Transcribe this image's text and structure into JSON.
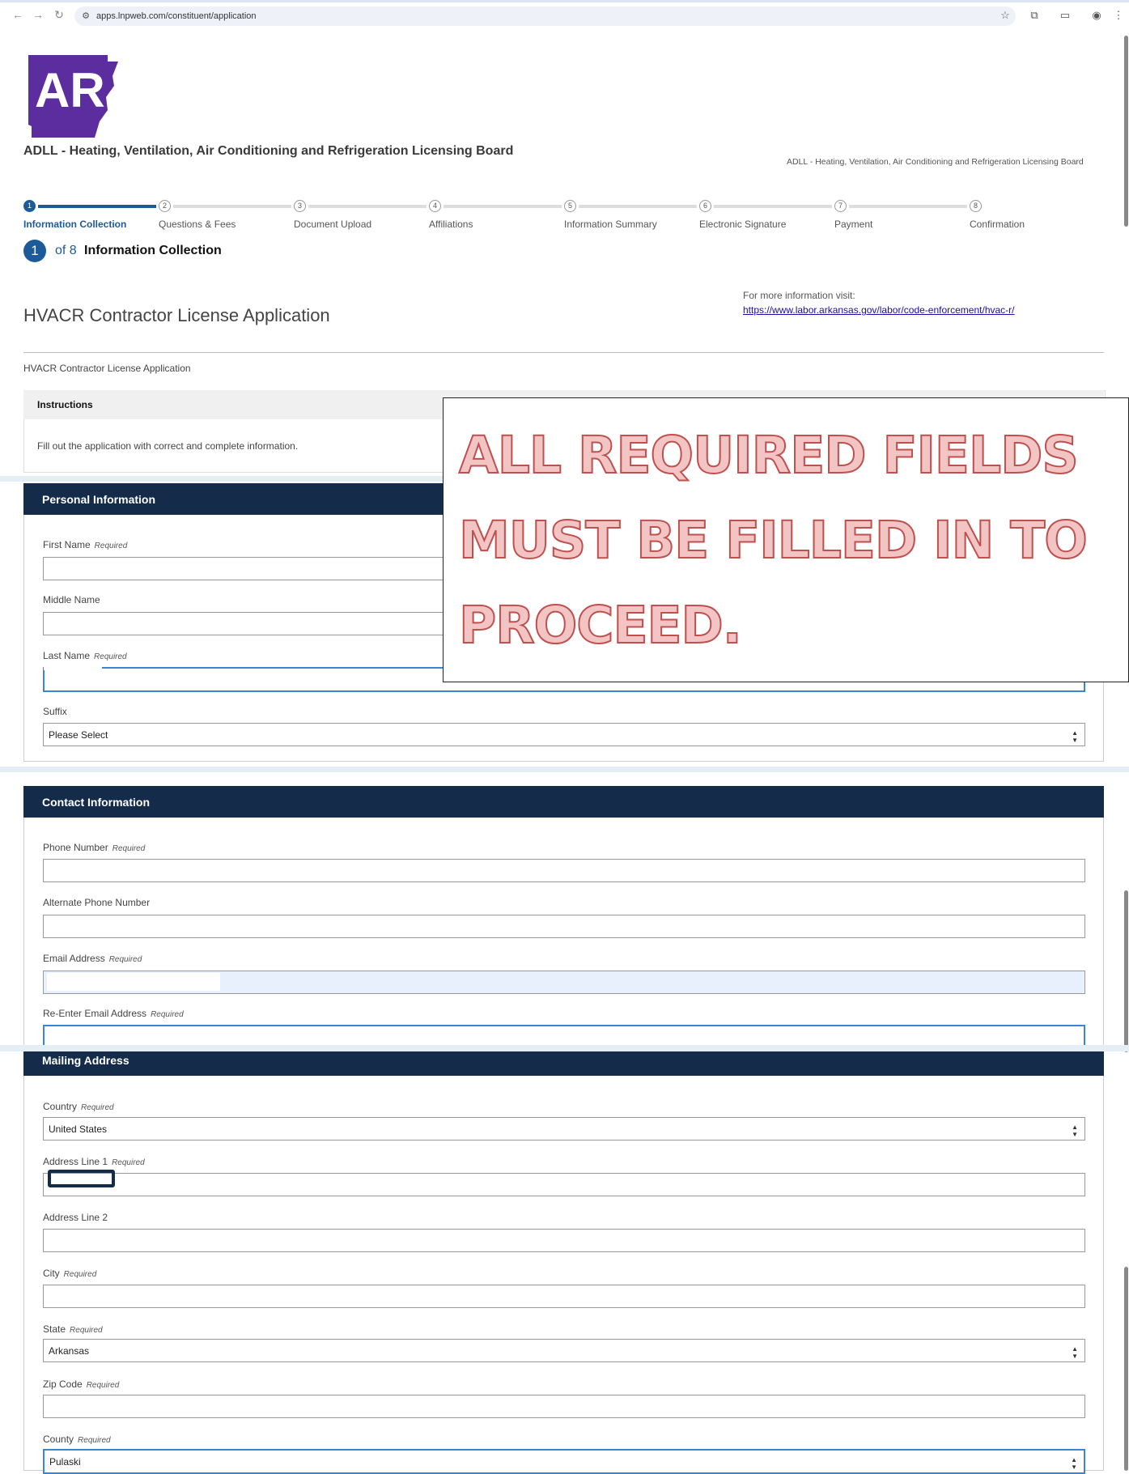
{
  "browser": {
    "url": "apps.lnpweb.com/constituent/application"
  },
  "header": {
    "board_title": "ADLL - Heating, Ventilation, Air Conditioning and Refrigeration Licensing Board",
    "board_subtitle": "ADLL - Heating, Ventilation, Air Conditioning and Refrigeration Licensing Board"
  },
  "stepper": {
    "steps": [
      {
        "num": "1",
        "label": "Information Collection"
      },
      {
        "num": "2",
        "label": "Questions & Fees"
      },
      {
        "num": "3",
        "label": "Document Upload"
      },
      {
        "num": "4",
        "label": "Affiliations"
      },
      {
        "num": "5",
        "label": "Information Summary"
      },
      {
        "num": "6",
        "label": "Electronic Signature"
      },
      {
        "num": "7",
        "label": "Payment"
      },
      {
        "num": "8",
        "label": "Confirmation"
      }
    ],
    "current_num": "1",
    "of_text": "of 8",
    "current_title": "Information Collection"
  },
  "application": {
    "title": "HVACR Contractor License Application",
    "more_info_label": "For more information visit:",
    "more_info_link": "https://www.labor.arkansas.gov/labor/code-enforcement/hvac-r/",
    "subtitle": "HVACR Contractor License Application"
  },
  "instructions": {
    "title": "Instructions",
    "text": "Fill out the application with correct and complete information."
  },
  "personal": {
    "title": "Personal Information",
    "first_name": "First Name",
    "middle_name": "Middle Name",
    "last_name": "Last Name",
    "suffix": "Suffix",
    "suffix_value": "Please Select",
    "required": "Required"
  },
  "contact": {
    "title": "Contact Information",
    "phone": "Phone Number",
    "alt_phone": "Alternate Phone Number",
    "email": "Email Address",
    "reemail": "Re-Enter Email Address",
    "required": "Required"
  },
  "mailing": {
    "title": "Mailing Address",
    "country": "Country",
    "country_value": "United States",
    "address1": "Address Line 1",
    "address2": "Address Line 2",
    "city": "City",
    "state": "State",
    "state_value": "Arkansas",
    "zip": "Zip Code",
    "county": "County",
    "county_value": "Pulaski",
    "required": "Required"
  },
  "overlay": {
    "text": "ALL REQUIRED FIELDS MUST BE FILLED IN TO PROCEED."
  },
  "logo": {
    "text": "AR"
  },
  "colors": {
    "primary": "#1d5a9a",
    "panel_header": "#142c4a",
    "focus": "#3a86d4",
    "logo_purple": "#5b2d9e"
  }
}
